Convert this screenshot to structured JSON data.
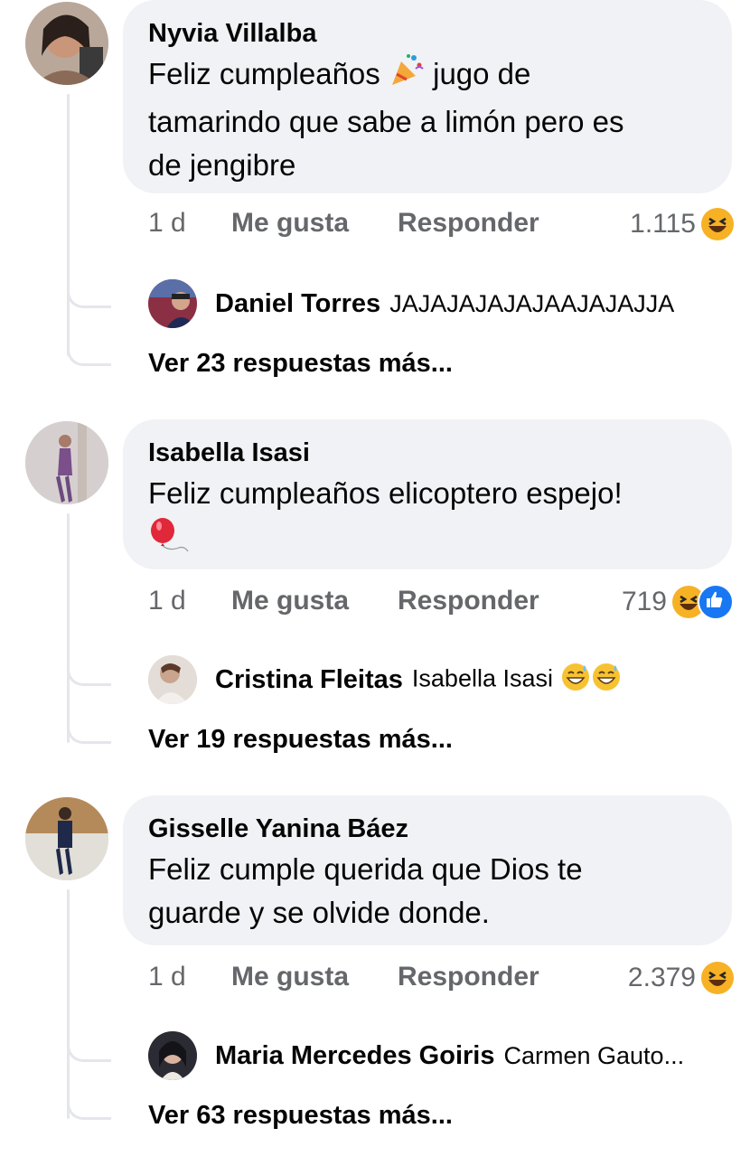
{
  "comments": [
    {
      "author": "Nyvia Villalba",
      "text_part1": "Feliz cumpleaños ",
      "text_part2": " jugo de\ntamarindo que sabe a limón pero es\nde jengibre",
      "emoji": "party-popper-icon",
      "time": "1 d",
      "like_label": "Me gusta",
      "reply_label": "Responder",
      "reaction_count": "1.115",
      "reactions": [
        "haha-reaction-icon"
      ],
      "reply": {
        "author": "Daniel Torres",
        "text": "JAJAJAJAJAJAAJAJAJJA"
      },
      "more_replies": "Ver 23 respuestas más..."
    },
    {
      "author": "Isabella Isasi",
      "text": "Feliz cumpleaños elicoptero espejo!",
      "emoji": "balloon-icon",
      "time": "1 d",
      "like_label": "Me gusta",
      "reply_label": "Responder",
      "reaction_count": "719",
      "reactions": [
        "haha-reaction-icon",
        "like-reaction-icon"
      ],
      "reply": {
        "author": "Cristina Fleitas",
        "text": "Isabella Isasi"
      },
      "more_replies": "Ver 19 respuestas más..."
    },
    {
      "author": "Gisselle Yanina Báez",
      "text": "Feliz cumple querida que Dios te\nguarde y se olvide donde.",
      "time": "1 d",
      "like_label": "Me gusta",
      "reply_label": "Responder",
      "reaction_count": "2.379",
      "reactions": [
        "haha-reaction-icon"
      ],
      "reply": {
        "author": "Maria Mercedes Goiris",
        "text": "Carmen Gauto..."
      },
      "more_replies": "Ver 63 respuestas más..."
    }
  ],
  "colors": {
    "bubble": "#f0f2f5",
    "meta_text": "#65676b",
    "haha": "#f7b125",
    "like": "#1877f2",
    "thread_line": "#e4e6eb"
  }
}
